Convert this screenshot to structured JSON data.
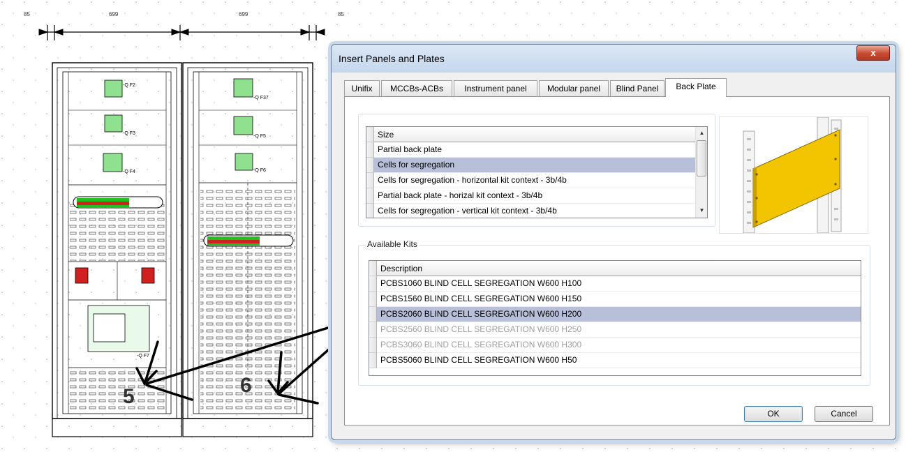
{
  "drawing": {
    "dimensions": [
      "85",
      "699",
      "699",
      "85"
    ],
    "component_labels": [
      "-Q F2",
      "-Q F3",
      "-Q F4",
      "-Q F37",
      "-Q F5",
      "-Q F6",
      "-Q F7"
    ],
    "callouts": [
      "5",
      "6"
    ]
  },
  "dialog": {
    "title": "Insert Panels and Plates",
    "close_glyph": "x",
    "tabs": [
      {
        "label": "Unifix"
      },
      {
        "label": "MCCBs-ACBs"
      },
      {
        "label": "Instrument panel"
      },
      {
        "label": "Modular panel"
      },
      {
        "label": "Blind Panel"
      },
      {
        "label": "Back Plate",
        "active": true
      }
    ],
    "size_grid": {
      "header": "Size",
      "rows": [
        {
          "label": "Partial back plate"
        },
        {
          "label": "Cells for segregation",
          "selected": true
        },
        {
          "label": "Cells for segregation - horizontal kit context - 3b/4b"
        },
        {
          "label": "Partial back plate - horizal kit context - 3b/4b"
        },
        {
          "label": "Cells for segregation - vertical kit context - 3b/4b"
        }
      ]
    },
    "kits_group_label": "Available Kits",
    "kits_grid": {
      "header": "Description",
      "rows": [
        {
          "label": "PCBS1060 BLIND CELL SEGREGATION W600 H100"
        },
        {
          "label": "PCBS1560 BLIND CELL SEGREGATION W600 H150"
        },
        {
          "label": "PCBS2060 BLIND CELL SEGREGATION W600 H200",
          "selected": true
        },
        {
          "label": "PCBS2560 BLIND CELL SEGREGATION W600 H250",
          "disabled": true
        },
        {
          "label": "PCBS3060 BLIND CELL SEGREGATION W600 H300",
          "disabled": true
        },
        {
          "label": "PCBS5060 BLIND CELL SEGREGATION W600 H50"
        }
      ]
    },
    "ok_label": "OK",
    "cancel_label": "Cancel",
    "preview_icon": "back-plate-preview",
    "colors": {
      "selection": "#b8bfd8",
      "plate": "#f2c500",
      "breaker": "#22c122",
      "busbar": "#d12020"
    }
  }
}
